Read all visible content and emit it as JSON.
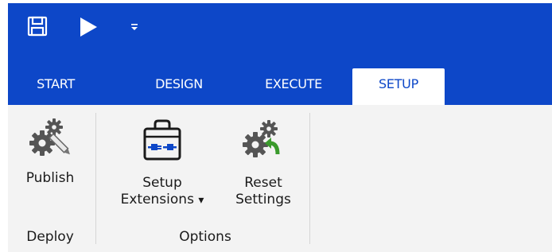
{
  "tabs": [
    {
      "label": "START",
      "active": false
    },
    {
      "label": "DESIGN",
      "active": false
    },
    {
      "label": "EXECUTE",
      "active": false
    },
    {
      "label": "SETUP",
      "active": true
    }
  ],
  "quick_access": {
    "icons": [
      "save-icon",
      "play-icon",
      "customize-dropdown-icon"
    ]
  },
  "ribbon": {
    "groups": [
      {
        "label": "Deploy",
        "buttons": [
          {
            "line1": "Publish",
            "icon": "gears-pencil-icon"
          }
        ]
      },
      {
        "label": "Options",
        "buttons": [
          {
            "line1": "Setup",
            "line2": "Extensions",
            "dropdown_arrow": "▾",
            "icon": "briefcase-plugin-icon"
          },
          {
            "line1": "Reset",
            "line2": "Settings",
            "icon": "gears-reset-icon"
          }
        ]
      }
    ]
  },
  "colors": {
    "titlebar": "#0d47c8",
    "ribbon_bg": "#f3f3f3",
    "active_tab_text": "#0d47c8",
    "reset_arrow": "#3a9a2c"
  }
}
